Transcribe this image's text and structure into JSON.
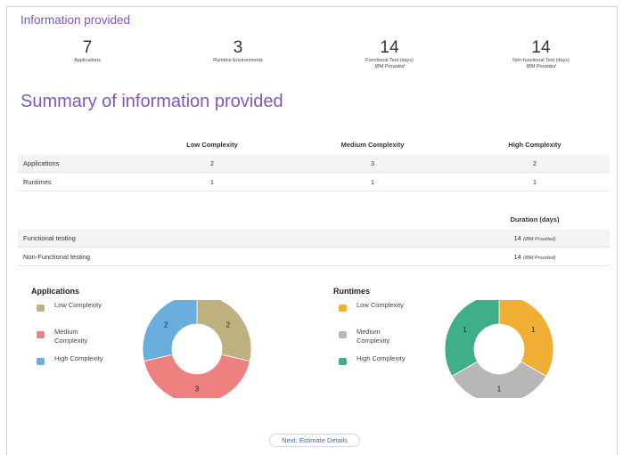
{
  "info": {
    "title": "Information provided",
    "stats": [
      {
        "value": "7",
        "label": "Applications",
        "sub": ""
      },
      {
        "value": "3",
        "label": "Runtime Environments",
        "sub": ""
      },
      {
        "value": "14",
        "label": "Functional Test (days)",
        "sub": "IBM Provided"
      },
      {
        "value": "14",
        "label": "Non-functional Test (days)",
        "sub": "IBM Provided"
      }
    ]
  },
  "summary": {
    "title": "Summary of information provided",
    "columns": [
      "Low Complexity",
      "Medium Complexity",
      "High Complexity"
    ],
    "rows": [
      {
        "label": "Applications",
        "values": [
          "2",
          "3",
          "2"
        ]
      },
      {
        "label": "Runtimes",
        "values": [
          "1",
          "1",
          "1"
        ]
      }
    ],
    "duration_header": "Duration (days)",
    "testing": [
      {
        "label": "Functional testing",
        "value": "14",
        "note": "(IBM Provided)"
      },
      {
        "label": "Non-Functional testing",
        "value": "14",
        "note": "(IBM Provided)"
      }
    ]
  },
  "charts": {
    "applications": {
      "title": "Applications",
      "legend": [
        {
          "label": "Low Complexity",
          "color": "#bfb17e"
        },
        {
          "label": "Medium Complexity",
          "color": "#ee8080"
        },
        {
          "label": "High Complexity",
          "color": "#6aaee0"
        }
      ]
    },
    "runtimes": {
      "title": "Runtimes",
      "legend": [
        {
          "label": "Low Complexity",
          "color": "#f0ae32"
        },
        {
          "label": "Medium Complexity",
          "color": "#b7b7b7"
        },
        {
          "label": "High Complexity",
          "color": "#3fae8a"
        }
      ]
    }
  },
  "chart_data": [
    {
      "type": "pie",
      "title": "Applications",
      "categories": [
        "Low Complexity",
        "Medium Complexity",
        "High Complexity"
      ],
      "values": [
        2,
        3,
        2
      ],
      "colors": [
        "#bfb17e",
        "#ee8080",
        "#6aaee0"
      ],
      "donut": true
    },
    {
      "type": "pie",
      "title": "Runtimes",
      "categories": [
        "Low Complexity",
        "Medium Complexity",
        "High Complexity"
      ],
      "values": [
        1,
        1,
        1
      ],
      "colors": [
        "#f0ae32",
        "#b7b7b7",
        "#3fae8a"
      ],
      "donut": true
    }
  ],
  "footer": {
    "next_label": "Next: Estimate Details"
  }
}
